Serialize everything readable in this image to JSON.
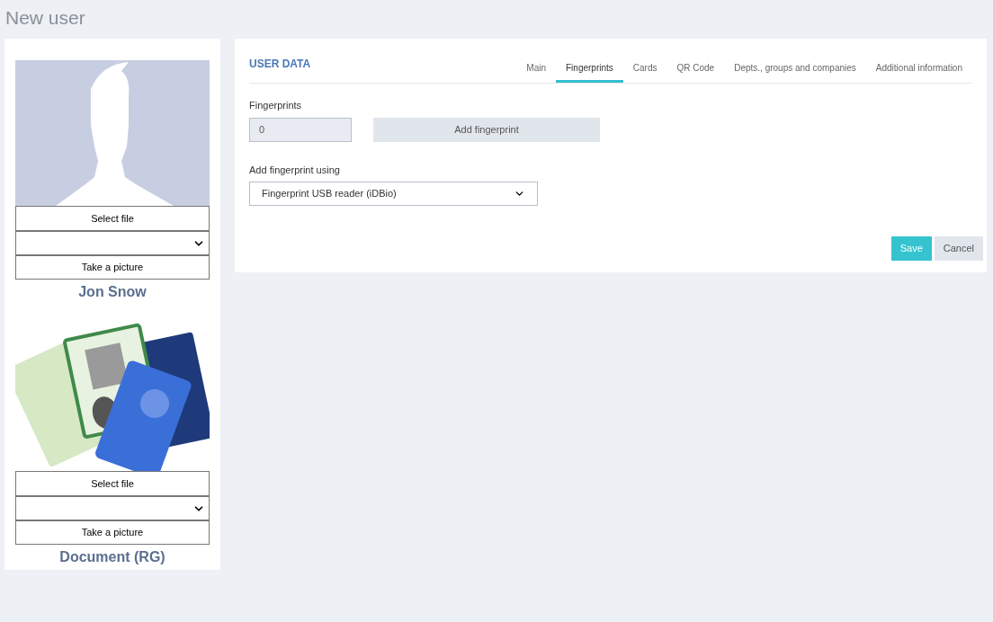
{
  "page_title": "New user",
  "photo_cards": [
    {
      "kind": "avatar",
      "select_button": "Select file",
      "take_button": "Take a picture",
      "caption": "Jon Snow"
    },
    {
      "kind": "picture",
      "select_button": "Select file",
      "take_button": "Take a picture",
      "caption": "Document (RG)"
    }
  ],
  "panel": {
    "title": "USER DATA",
    "tabs": [
      {
        "label": "Main",
        "selected": false
      },
      {
        "label": "Fingerprints",
        "selected": true
      },
      {
        "label": "Cards",
        "selected": false
      },
      {
        "label": "QR Code",
        "selected": false
      },
      {
        "label": "Depts., groups and companies",
        "selected": false
      },
      {
        "label": "Additional information",
        "selected": false
      }
    ],
    "fingerprints_label": "Fingerprints",
    "fingerprints_value": "0",
    "add_button": "Add fingerprint",
    "method_label": "Add fingerprint using",
    "method_value": "Fingerprint USB reader (iDBio)",
    "buttons": [
      {
        "label": "Save",
        "kind": "primary"
      },
      {
        "label": "Cancel",
        "kind": "secondary"
      }
    ]
  }
}
